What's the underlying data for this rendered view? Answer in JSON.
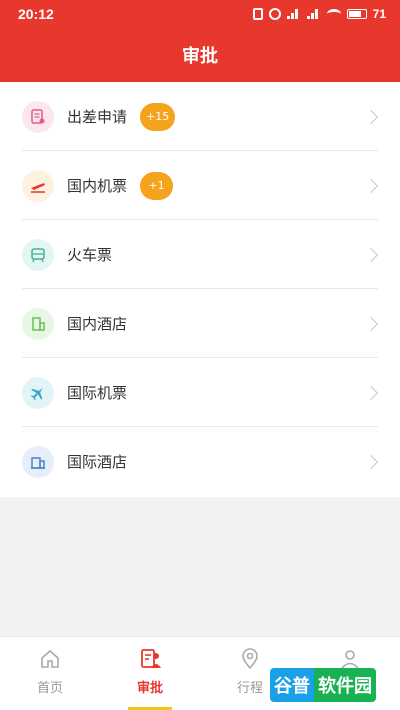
{
  "status_bar": {
    "time": "20:12",
    "battery": "71"
  },
  "header": {
    "title": "审批"
  },
  "menu": [
    {
      "label": "出差申请",
      "badge": "+15",
      "icon": "document-icon",
      "icon_bg": "#fde7ef",
      "icon_color": "#e45a8c"
    },
    {
      "label": "国内机票",
      "badge": "+1",
      "icon": "plane-takeoff-icon",
      "icon_bg": "#fff1e0",
      "icon_color": "#e8382e"
    },
    {
      "label": "火车票",
      "badge": null,
      "icon": "train-icon",
      "icon_bg": "#e3f6f1",
      "icon_color": "#3cb39a"
    },
    {
      "label": "国内酒店",
      "badge": null,
      "icon": "hotel-icon",
      "icon_bg": "#e8f6e4",
      "icon_color": "#6cbf55"
    },
    {
      "label": "国际机票",
      "badge": null,
      "icon": "plane-icon",
      "icon_bg": "#e3f4f8",
      "icon_color": "#3aa8c4"
    },
    {
      "label": "国际酒店",
      "badge": null,
      "icon": "intl-hotel-icon",
      "icon_bg": "#e5eefa",
      "icon_color": "#4a86c8"
    }
  ],
  "tabs": [
    {
      "label": "首页",
      "icon": "home-icon",
      "active": false
    },
    {
      "label": "审批",
      "icon": "approval-icon",
      "active": true
    },
    {
      "label": "行程",
      "icon": "location-icon",
      "active": false
    },
    {
      "label": "",
      "icon": "user-icon",
      "active": false
    }
  ],
  "watermark": {
    "part1": "谷普",
    "part2": "软件园"
  },
  "colors": {
    "primary": "#e8382e",
    "badge": "#f5a21c",
    "tab_indicator": "#f5c518"
  }
}
